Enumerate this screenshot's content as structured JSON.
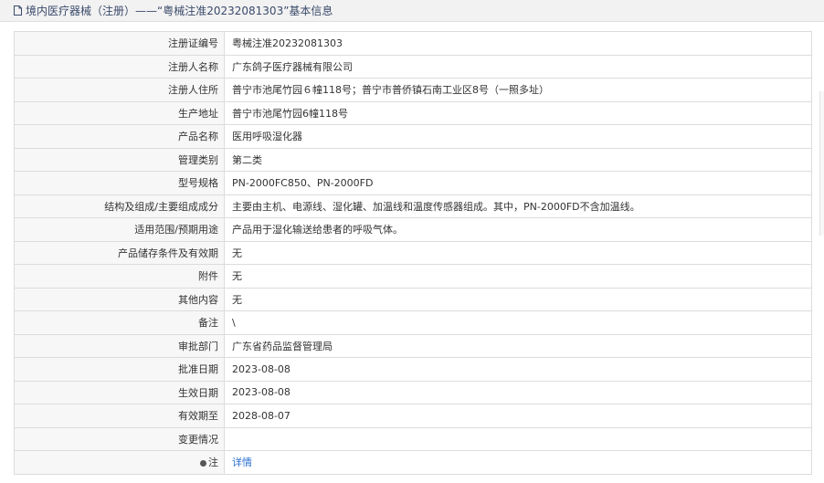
{
  "header": {
    "title": "境内医疗器械（注册）——“粤械注准20232081303”基本信息"
  },
  "rows": [
    {
      "label": "注册证编号",
      "value": "粤械注准20232081303"
    },
    {
      "label": "注册人名称",
      "value": "广东鸽子医疗器械有限公司"
    },
    {
      "label": "注册人住所",
      "value": "普宁市池尾竹园６幢118号；普宁市普侨镇石南工业区8号（一照多址）"
    },
    {
      "label": "生产地址",
      "value": "普宁市池尾竹园6幢118号"
    },
    {
      "label": "产品名称",
      "value": "医用呼吸湿化器"
    },
    {
      "label": "管理类别",
      "value": "第二类"
    },
    {
      "label": "型号规格",
      "value": "PN-2000FC850、PN-2000FD"
    },
    {
      "label": "结构及组成/主要组成成分",
      "value": "主要由主机、电源线、湿化罐、加温线和温度传感器组成。其中，PN-2000FD不含加温线。"
    },
    {
      "label": "适用范围/预期用途",
      "value": "产品用于湿化输送给患者的呼吸气体。"
    },
    {
      "label": "产品储存条件及有效期",
      "value": "无"
    },
    {
      "label": "附件",
      "value": "无"
    },
    {
      "label": "其他内容",
      "value": "无"
    },
    {
      "label": "备注",
      "value": "\\"
    },
    {
      "label": "审批部门",
      "value": "广东省药品监督管理局"
    },
    {
      "label": "批准日期",
      "value": "2023-08-08"
    },
    {
      "label": "生效日期",
      "value": "2023-08-08"
    },
    {
      "label": "有效期至",
      "value": "2028-08-07"
    },
    {
      "label": "变更情况",
      "value": ""
    }
  ],
  "note_row": {
    "label": "注",
    "link": "详情"
  }
}
